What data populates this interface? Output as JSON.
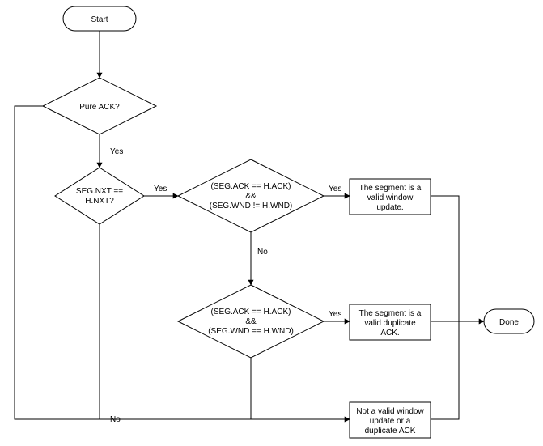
{
  "nodes": {
    "start": {
      "label": "Start"
    },
    "done": {
      "label": "Done"
    },
    "d_pure": {
      "label": "Pure ACK?"
    },
    "d_nxt": {
      "label1": "SEG.NXT ==",
      "label2": "H.NXT?"
    },
    "d_wnd_ne": {
      "label1": "(SEG.ACK == H.ACK)",
      "label2": "&&",
      "label3": "(SEG.WND != H.WND)"
    },
    "d_wnd_eq": {
      "label1": "(SEG.ACK == H.ACK)",
      "label2": "&&",
      "label3": "(SEG.WND == H.WND)"
    },
    "p_winupd": {
      "label1": "The segment is a",
      "label2": "valid window",
      "label3": "update."
    },
    "p_dupack": {
      "label1": "The segment is a",
      "label2": "valid duplicate",
      "label3": "ACK."
    },
    "p_not": {
      "label1": "Not a valid window",
      "label2": "update or a",
      "label3": "duplicate ACK"
    }
  },
  "edges": {
    "yes": "Yes",
    "no": "No"
  }
}
